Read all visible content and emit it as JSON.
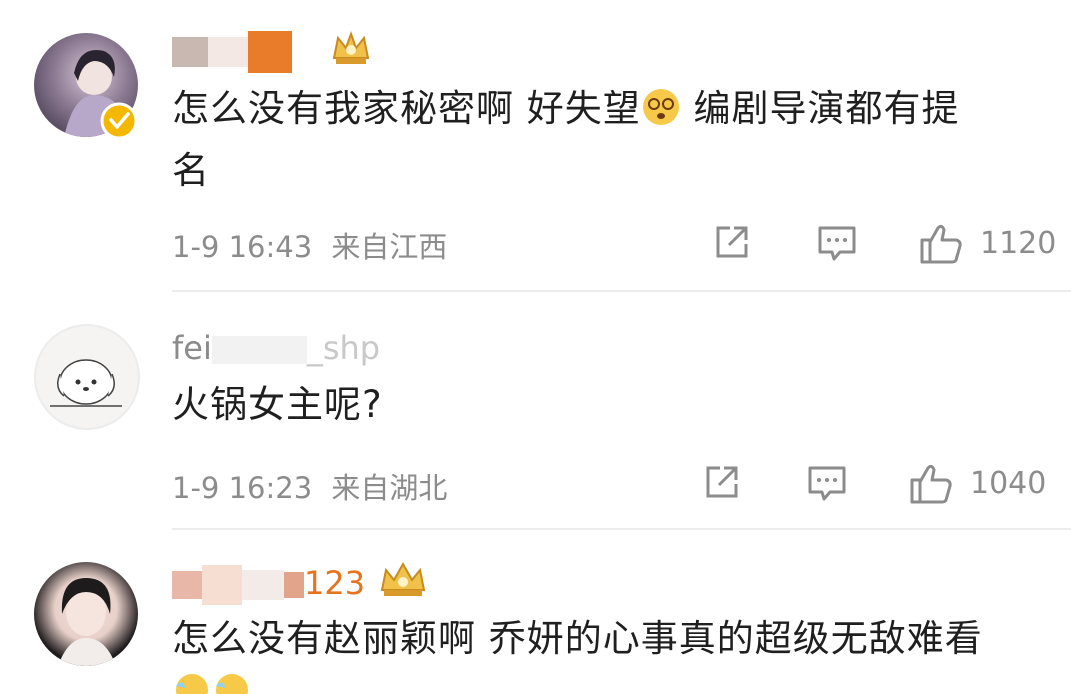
{
  "comments": [
    {
      "username_visible": "",
      "text_line1": "怎么没有我家秘密啊 好失望",
      "text_line1b": " 编剧导演都有提",
      "text_line2": "名",
      "date": "1-9 16:43",
      "location": "来自江西",
      "likes": "1120",
      "verified": true
    },
    {
      "username_visible": "fei",
      "username_tail": "_shp",
      "text_line1": "火锅女主呢?",
      "date": "1-9 16:23",
      "location": "来自湖北",
      "likes": "1040"
    },
    {
      "username_visible": "123",
      "text_line1": "怎么没有赵丽颖啊 乔妍的心事真的超级无敌难看"
    }
  ],
  "icons": {
    "share": "share-icon",
    "comment": "comment-icon",
    "like": "thumbs-up-icon"
  },
  "colors": {
    "text": "#1f1f1f",
    "meta": "#8c8c8c",
    "divider": "#ececec",
    "badge_gold": "#e6a93a",
    "verified": "#f5b800"
  }
}
